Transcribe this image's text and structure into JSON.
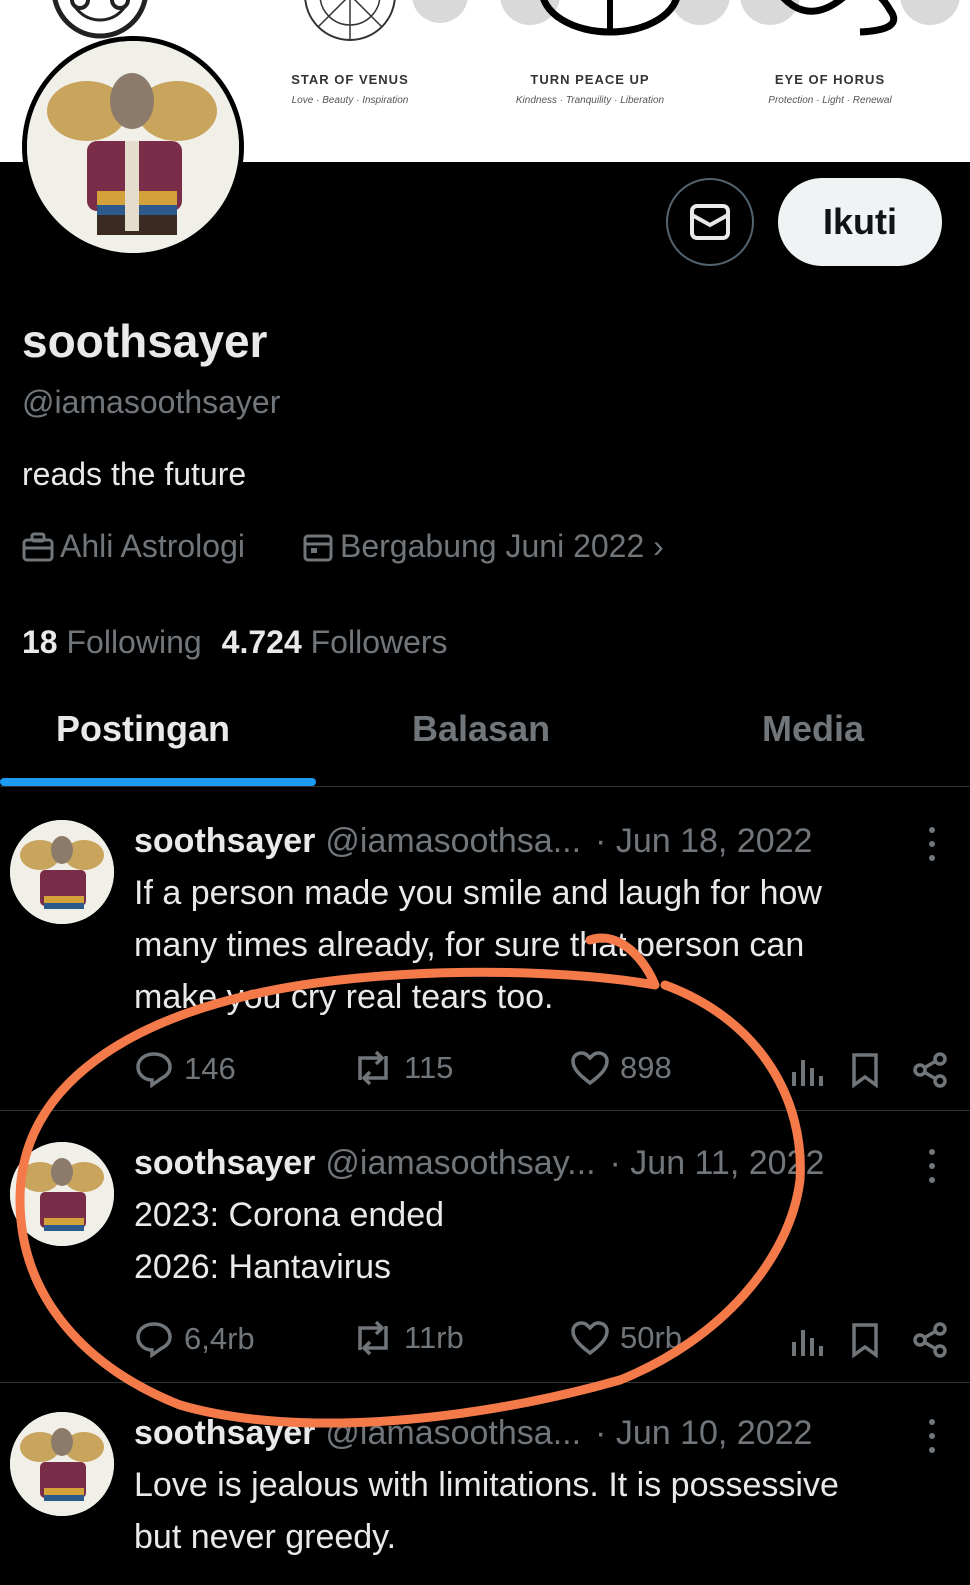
{
  "banner": {
    "symbols": [
      {
        "name": "STAR OF VENUS",
        "sub": "Love · Beauty · Inspiration"
      },
      {
        "name": "TURN PEACE UP",
        "sub": "Kindness · Tranquility · Liberation"
      },
      {
        "name": "EYE OF HORUS",
        "sub": "Protection · Light · Renewal"
      }
    ]
  },
  "profile": {
    "name": "soothsayer",
    "handle": "@iamasoothsayer",
    "bio": "reads the future",
    "category": "Ahli Astrologi",
    "joined": "Bergabung Juni 2022 ›",
    "following_count": "18",
    "following_label": "Following",
    "followers_count": "4.724",
    "followers_label": "Followers",
    "follow_button": "Ikuti",
    "message_icon": "envelope-icon"
  },
  "tabs": [
    {
      "label": "Postingan",
      "active": true
    },
    {
      "label": "Balasan",
      "active": false
    },
    {
      "label": "Media",
      "active": false
    }
  ],
  "posts": [
    {
      "name": "soothsayer",
      "handle": "@iamasoothsa...",
      "date": "· Jun 18, 2022",
      "lines": [
        "If a person made you smile and laugh for how",
        "many times already, for sure that person can",
        "make you cry real tears too."
      ],
      "replies": "146",
      "reposts": "115",
      "likes": "898"
    },
    {
      "name": "soothsayer",
      "handle": "@iamasoothsay...",
      "date": "· Jun 11, 2022",
      "lines": [
        "2023: Corona ended",
        "2026: Hantavirus"
      ],
      "replies": "6,4rb",
      "reposts": "11rb",
      "likes": "50rb"
    },
    {
      "name": "soothsayer",
      "handle": "@iamasoothsa...",
      "date": "· Jun 10, 2022",
      "lines": [
        "Love is jealous with limitations. It is possessive",
        "but never greedy."
      ]
    }
  ],
  "colors": {
    "background": "#000000",
    "text": "#e7e9ea",
    "muted": "#71767b",
    "accent": "#1d9bf0",
    "annotation": "#f47a4a"
  }
}
